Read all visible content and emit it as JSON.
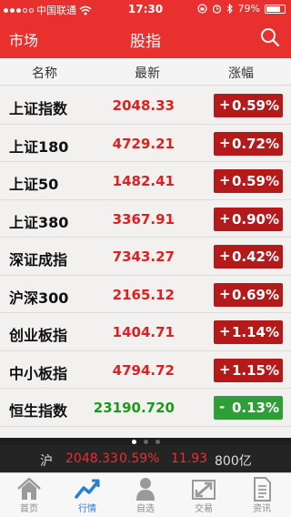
{
  "status_bar": {
    "carrier": "中国联通",
    "time": "17:30",
    "battery": "79%",
    "battery_level": 0.79
  },
  "nav": {
    "left_label": "市场",
    "title": "股指",
    "search_icon": "search-icon"
  },
  "columns": {
    "name": "名称",
    "latest": "最新",
    "change": "涨幅"
  },
  "rows": [
    {
      "name": "上证指数",
      "price": "2048.33",
      "sign": "+",
      "pct": "0.59%",
      "direction": "up"
    },
    {
      "name": "上证180",
      "price": "4729.21",
      "sign": "+",
      "pct": "0.72%",
      "direction": "up"
    },
    {
      "name": "上证50",
      "price": "1482.41",
      "sign": "+",
      "pct": "0.59%",
      "direction": "up"
    },
    {
      "name": "上证380",
      "price": "3367.91",
      "sign": "+",
      "pct": "0.90%",
      "direction": "up"
    },
    {
      "name": "深证成指",
      "price": "7343.27",
      "sign": "+",
      "pct": "0.42%",
      "direction": "up"
    },
    {
      "name": "沪深300",
      "price": "2165.12",
      "sign": "+",
      "pct": "0.69%",
      "direction": "up"
    },
    {
      "name": "创业板指",
      "price": "1404.71",
      "sign": "+",
      "pct": "1.14%",
      "direction": "up"
    },
    {
      "name": "中小板指",
      "price": "4794.72",
      "sign": "+",
      "pct": "1.15%",
      "direction": "up"
    },
    {
      "name": "恒生指数",
      "price": "23190.720",
      "sign": "-",
      "pct": "0.13%",
      "direction": "down"
    }
  ],
  "ticker": {
    "name": "沪",
    "price": "2048.33",
    "pct": "0.59%",
    "change": "11.93",
    "volume": "800亿"
  },
  "tabs": [
    {
      "label": "首页",
      "icon": "home-icon"
    },
    {
      "label": "行情",
      "icon": "chart-trend-icon",
      "active": true
    },
    {
      "label": "自选",
      "icon": "person-icon"
    },
    {
      "label": "交易",
      "icon": "exchange-arrows-icon"
    },
    {
      "label": "资讯",
      "icon": "document-icon"
    }
  ],
  "colors": {
    "brand_red": "#e8302f",
    "up_red": "#e02020",
    "down_green": "#1a9a1a",
    "badge_up": "#b51a1a",
    "badge_down": "#2e9e37",
    "tab_active": "#2a7fd4"
  }
}
